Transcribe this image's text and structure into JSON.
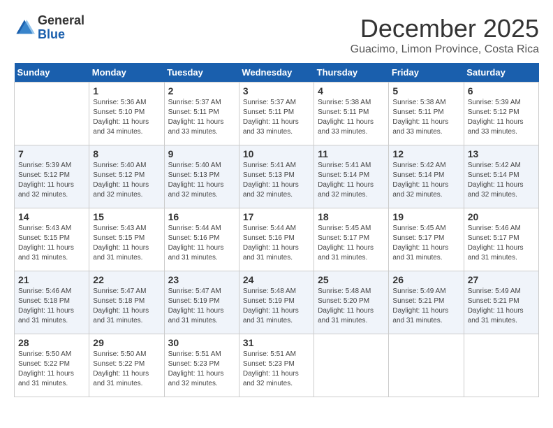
{
  "logo": {
    "line1": "General",
    "line2": "Blue"
  },
  "title": "December 2025",
  "subtitle": "Guacimo, Limon Province, Costa Rica",
  "days_of_week": [
    "Sunday",
    "Monday",
    "Tuesday",
    "Wednesday",
    "Thursday",
    "Friday",
    "Saturday"
  ],
  "weeks": [
    [
      {
        "day": "",
        "sunrise": "",
        "sunset": "",
        "daylight": ""
      },
      {
        "day": "1",
        "sunrise": "Sunrise: 5:36 AM",
        "sunset": "Sunset: 5:10 PM",
        "daylight": "Daylight: 11 hours and 34 minutes."
      },
      {
        "day": "2",
        "sunrise": "Sunrise: 5:37 AM",
        "sunset": "Sunset: 5:11 PM",
        "daylight": "Daylight: 11 hours and 33 minutes."
      },
      {
        "day": "3",
        "sunrise": "Sunrise: 5:37 AM",
        "sunset": "Sunset: 5:11 PM",
        "daylight": "Daylight: 11 hours and 33 minutes."
      },
      {
        "day": "4",
        "sunrise": "Sunrise: 5:38 AM",
        "sunset": "Sunset: 5:11 PM",
        "daylight": "Daylight: 11 hours and 33 minutes."
      },
      {
        "day": "5",
        "sunrise": "Sunrise: 5:38 AM",
        "sunset": "Sunset: 5:11 PM",
        "daylight": "Daylight: 11 hours and 33 minutes."
      },
      {
        "day": "6",
        "sunrise": "Sunrise: 5:39 AM",
        "sunset": "Sunset: 5:12 PM",
        "daylight": "Daylight: 11 hours and 33 minutes."
      }
    ],
    [
      {
        "day": "7",
        "sunrise": "Sunrise: 5:39 AM",
        "sunset": "Sunset: 5:12 PM",
        "daylight": "Daylight: 11 hours and 32 minutes."
      },
      {
        "day": "8",
        "sunrise": "Sunrise: 5:40 AM",
        "sunset": "Sunset: 5:12 PM",
        "daylight": "Daylight: 11 hours and 32 minutes."
      },
      {
        "day": "9",
        "sunrise": "Sunrise: 5:40 AM",
        "sunset": "Sunset: 5:13 PM",
        "daylight": "Daylight: 11 hours and 32 minutes."
      },
      {
        "day": "10",
        "sunrise": "Sunrise: 5:41 AM",
        "sunset": "Sunset: 5:13 PM",
        "daylight": "Daylight: 11 hours and 32 minutes."
      },
      {
        "day": "11",
        "sunrise": "Sunrise: 5:41 AM",
        "sunset": "Sunset: 5:14 PM",
        "daylight": "Daylight: 11 hours and 32 minutes."
      },
      {
        "day": "12",
        "sunrise": "Sunrise: 5:42 AM",
        "sunset": "Sunset: 5:14 PM",
        "daylight": "Daylight: 11 hours and 32 minutes."
      },
      {
        "day": "13",
        "sunrise": "Sunrise: 5:42 AM",
        "sunset": "Sunset: 5:14 PM",
        "daylight": "Daylight: 11 hours and 32 minutes."
      }
    ],
    [
      {
        "day": "14",
        "sunrise": "Sunrise: 5:43 AM",
        "sunset": "Sunset: 5:15 PM",
        "daylight": "Daylight: 11 hours and 31 minutes."
      },
      {
        "day": "15",
        "sunrise": "Sunrise: 5:43 AM",
        "sunset": "Sunset: 5:15 PM",
        "daylight": "Daylight: 11 hours and 31 minutes."
      },
      {
        "day": "16",
        "sunrise": "Sunrise: 5:44 AM",
        "sunset": "Sunset: 5:16 PM",
        "daylight": "Daylight: 11 hours and 31 minutes."
      },
      {
        "day": "17",
        "sunrise": "Sunrise: 5:44 AM",
        "sunset": "Sunset: 5:16 PM",
        "daylight": "Daylight: 11 hours and 31 minutes."
      },
      {
        "day": "18",
        "sunrise": "Sunrise: 5:45 AM",
        "sunset": "Sunset: 5:17 PM",
        "daylight": "Daylight: 11 hours and 31 minutes."
      },
      {
        "day": "19",
        "sunrise": "Sunrise: 5:45 AM",
        "sunset": "Sunset: 5:17 PM",
        "daylight": "Daylight: 11 hours and 31 minutes."
      },
      {
        "day": "20",
        "sunrise": "Sunrise: 5:46 AM",
        "sunset": "Sunset: 5:17 PM",
        "daylight": "Daylight: 11 hours and 31 minutes."
      }
    ],
    [
      {
        "day": "21",
        "sunrise": "Sunrise: 5:46 AM",
        "sunset": "Sunset: 5:18 PM",
        "daylight": "Daylight: 11 hours and 31 minutes."
      },
      {
        "day": "22",
        "sunrise": "Sunrise: 5:47 AM",
        "sunset": "Sunset: 5:18 PM",
        "daylight": "Daylight: 11 hours and 31 minutes."
      },
      {
        "day": "23",
        "sunrise": "Sunrise: 5:47 AM",
        "sunset": "Sunset: 5:19 PM",
        "daylight": "Daylight: 11 hours and 31 minutes."
      },
      {
        "day": "24",
        "sunrise": "Sunrise: 5:48 AM",
        "sunset": "Sunset: 5:19 PM",
        "daylight": "Daylight: 11 hours and 31 minutes."
      },
      {
        "day": "25",
        "sunrise": "Sunrise: 5:48 AM",
        "sunset": "Sunset: 5:20 PM",
        "daylight": "Daylight: 11 hours and 31 minutes."
      },
      {
        "day": "26",
        "sunrise": "Sunrise: 5:49 AM",
        "sunset": "Sunset: 5:21 PM",
        "daylight": "Daylight: 11 hours and 31 minutes."
      },
      {
        "day": "27",
        "sunrise": "Sunrise: 5:49 AM",
        "sunset": "Sunset: 5:21 PM",
        "daylight": "Daylight: 11 hours and 31 minutes."
      }
    ],
    [
      {
        "day": "28",
        "sunrise": "Sunrise: 5:50 AM",
        "sunset": "Sunset: 5:22 PM",
        "daylight": "Daylight: 11 hours and 31 minutes."
      },
      {
        "day": "29",
        "sunrise": "Sunrise: 5:50 AM",
        "sunset": "Sunset: 5:22 PM",
        "daylight": "Daylight: 11 hours and 31 minutes."
      },
      {
        "day": "30",
        "sunrise": "Sunrise: 5:51 AM",
        "sunset": "Sunset: 5:23 PM",
        "daylight": "Daylight: 11 hours and 32 minutes."
      },
      {
        "day": "31",
        "sunrise": "Sunrise: 5:51 AM",
        "sunset": "Sunset: 5:23 PM",
        "daylight": "Daylight: 11 hours and 32 minutes."
      },
      {
        "day": "",
        "sunrise": "",
        "sunset": "",
        "daylight": ""
      },
      {
        "day": "",
        "sunrise": "",
        "sunset": "",
        "daylight": ""
      },
      {
        "day": "",
        "sunrise": "",
        "sunset": "",
        "daylight": ""
      }
    ]
  ]
}
